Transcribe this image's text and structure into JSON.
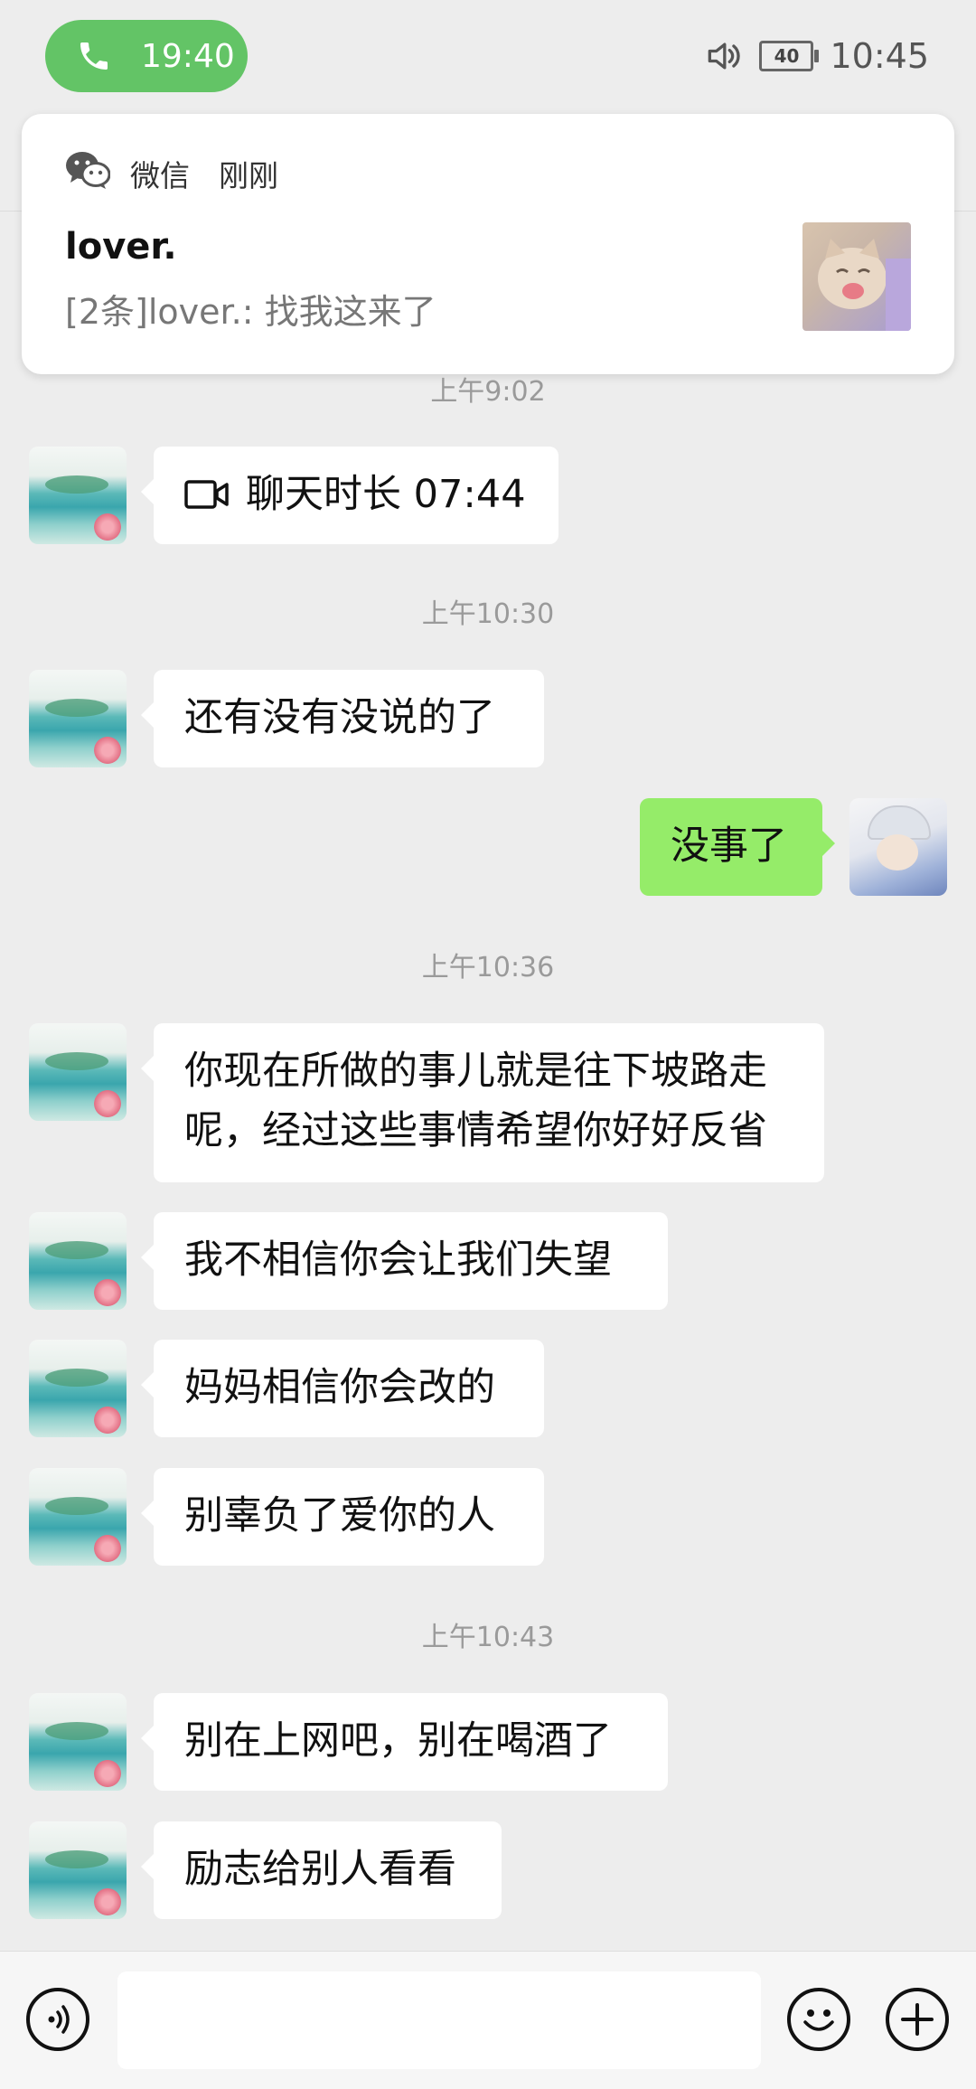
{
  "status_bar": {
    "call_time": "19:40",
    "battery_level": "40",
    "clock": "10:45",
    "call_color": "#63c466"
  },
  "notification": {
    "app_name": "微信",
    "when": "刚刚",
    "sender": "lover.",
    "preview": "[2条]lover.: 找我这来了"
  },
  "timestamps": [
    "上午9:02",
    "上午10:30",
    "上午10:36",
    "上午10:43"
  ],
  "messages": [
    {
      "direction": "in",
      "text": "聊天时长 07:44",
      "icon": "video-call-icon"
    },
    {
      "direction": "in",
      "text": "还有没有没说的了"
    },
    {
      "direction": "out",
      "text": "没事了"
    },
    {
      "direction": "in",
      "lines": [
        "你现在所做的事儿就是往下坡路走",
        "呢，经过这些事情希望你好好反省"
      ]
    },
    {
      "direction": "in",
      "text": "我不相信你会让我们失望"
    },
    {
      "direction": "in",
      "text": "妈妈相信你会改的"
    },
    {
      "direction": "in",
      "text": "别辜负了爱你的人"
    },
    {
      "direction": "in",
      "text": "别在上网吧，别在喝酒了"
    },
    {
      "direction": "in",
      "text": "励志给别人看看"
    }
  ],
  "input_bar": {
    "voice_icon": "voice-icon",
    "emoji_icon": "emoji-icon",
    "plus_icon": "plus-icon",
    "input_value": ""
  },
  "colors": {
    "outgoing_bubble": "#95ec69",
    "incoming_bubble": "#ffffff",
    "background": "#ededed"
  }
}
